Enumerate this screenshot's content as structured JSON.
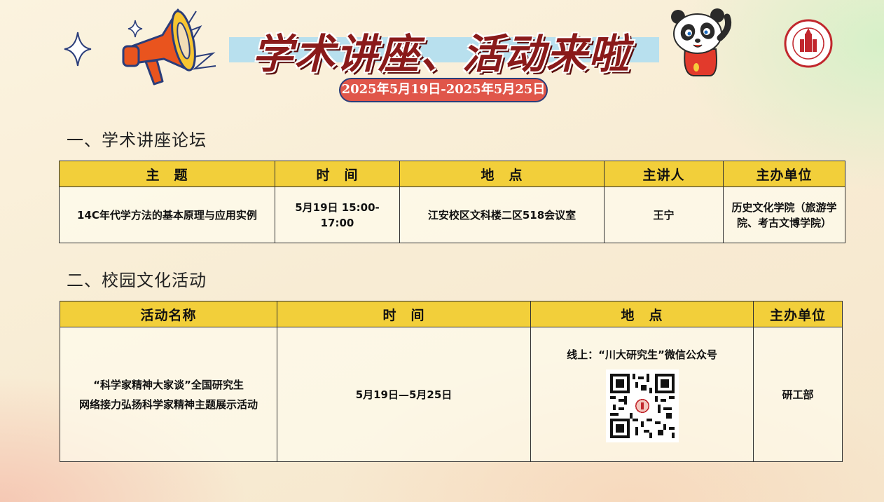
{
  "header": {
    "title": "学术讲座、活动来啦",
    "date_range": "2025年5月19日-2025年5月25日"
  },
  "colors": {
    "header_fill": "#f2cf3a",
    "title_band": "#b8e0ee",
    "title_text": "#8a1a1a",
    "date_pill": "#e0564a"
  },
  "section1": {
    "title": "一、学术讲座论坛",
    "headers": [
      "主　题",
      "时　间",
      "地　点",
      "主讲人",
      "主办单位"
    ],
    "rows": [
      {
        "topic": "14C年代学方法的基本原理与应用实例",
        "time": "5月19日 15:00-17:00",
        "location": "江安校区文科楼二区518会议室",
        "speaker": "王宁",
        "organizer": "历史文化学院（旅游学院、考古文博学院）"
      }
    ]
  },
  "section2": {
    "title": "二、校园文化活动",
    "headers": [
      "活动名称",
      "时　间",
      "地　点",
      "主办单位"
    ],
    "rows": [
      {
        "name_line1": "“科学家精神大家谈”全国研究生",
        "name_line2": "网络接力弘扬科学家精神主题展示活动",
        "time": "5月19日—5月25日",
        "location": "线上：“川大研究生”微信公众号",
        "organizer": "研工部"
      }
    ]
  },
  "icons": [
    "megaphone-icon",
    "sparkle-icon",
    "panda-mascot-icon",
    "university-seal-icon",
    "qr-code-icon"
  ]
}
